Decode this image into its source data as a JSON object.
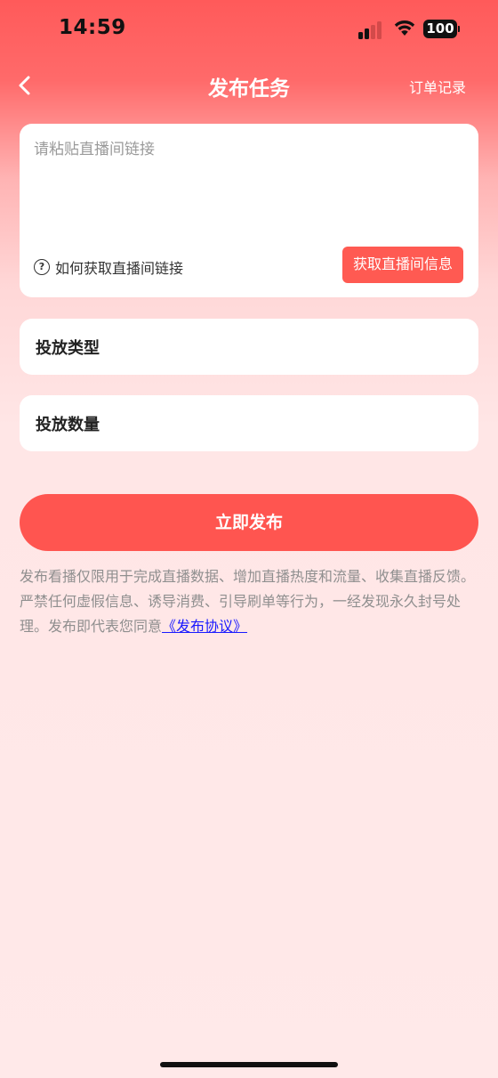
{
  "status_bar": {
    "time": "14:59",
    "battery": "100"
  },
  "nav": {
    "title": "发布任务",
    "right_link": "订单记录",
    "back_icon": "chevron-left-icon"
  },
  "link_card": {
    "input_placeholder": "请粘贴直播间链接",
    "input_value": "",
    "help_icon": "question-circle-icon",
    "help_text": "如何获取直播间链接",
    "fetch_button": "获取直播间信息"
  },
  "fields": {
    "type_label": "投放类型",
    "quantity_label": "投放数量"
  },
  "publish_button": "立即发布",
  "notice": {
    "text": "发布看播仅限用于完成直播数据、增加直播热度和流量、收集直播反馈。严禁任何虚假信息、诱导消费、引导刷单等行为，一经发现永久封号处理。发布即代表您同意",
    "agreement_link": "《发布协议》"
  },
  "colors": {
    "accent": "#ff5550",
    "link": "#1a1aff"
  }
}
